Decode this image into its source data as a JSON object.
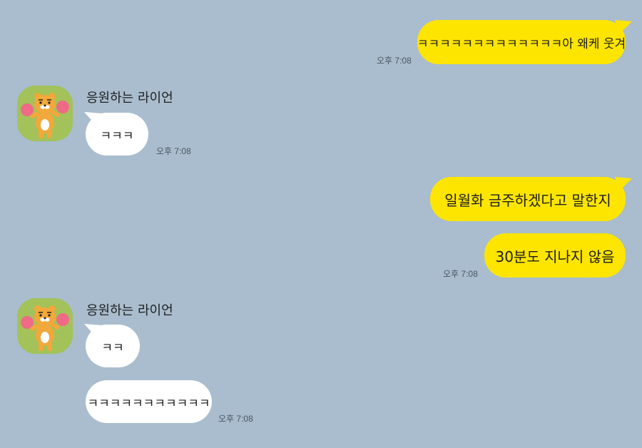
{
  "chat": {
    "messages": [
      {
        "id": "m1",
        "side": "me",
        "text": "ㅋㅋㅋㅋㅋㅋㅋㅋㅋㅋㅋㅋㅋ아 왜케 웃겨",
        "time": "오후 7:08"
      },
      {
        "id": "m2",
        "side": "them",
        "sender": "응원하는 라이언",
        "text": "ㅋㅋㅋ",
        "time": "오후 7:08"
      },
      {
        "id": "m3",
        "side": "me",
        "text": "일월화 금주하겠다고 말한지"
      },
      {
        "id": "m4",
        "side": "me",
        "text": "30분도 지나지 않음",
        "time": "오후 7:08"
      },
      {
        "id": "m5",
        "side": "them",
        "sender": "응원하는 라이언",
        "text": "ㅋㅋ"
      },
      {
        "id": "m6",
        "side": "them",
        "text": "ㅋㅋㅋㅋㅋㅋㅋㅋㅋㅋㅋ",
        "time": "오후 7:08"
      }
    ]
  },
  "colors": {
    "background": "#a9bdce",
    "my_bubble": "#fee500",
    "their_bubble": "#ffffff",
    "avatar_bg": "#a3c25a"
  },
  "icons": {
    "avatar": "ryan-cheering-avatar-icon"
  }
}
